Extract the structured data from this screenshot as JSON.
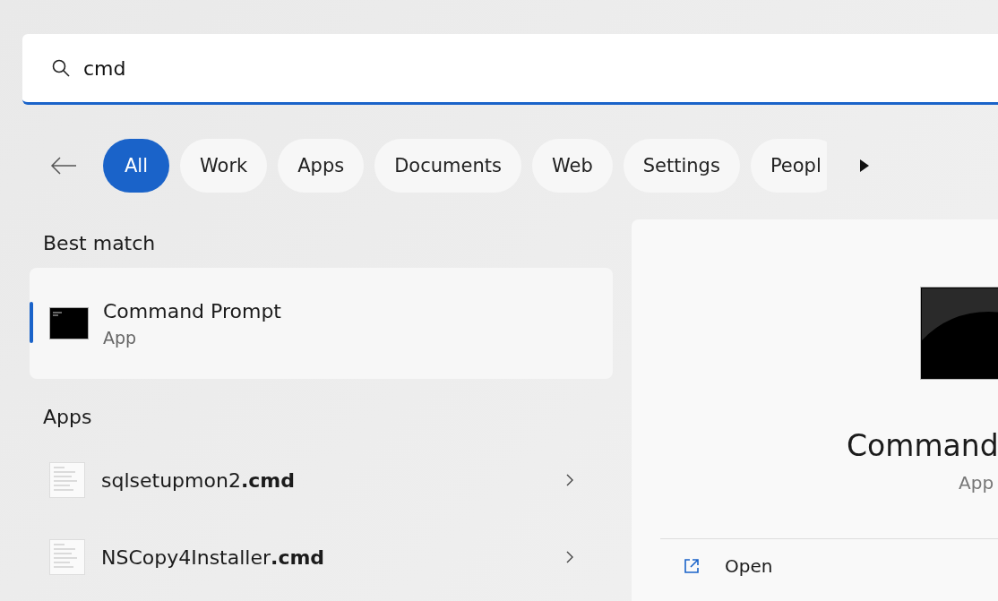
{
  "search": {
    "value": "cmd"
  },
  "filters": [
    {
      "label": "All",
      "selected": true
    },
    {
      "label": "Work",
      "selected": false
    },
    {
      "label": "Apps",
      "selected": false
    },
    {
      "label": "Documents",
      "selected": false
    },
    {
      "label": "Web",
      "selected": false
    },
    {
      "label": "Settings",
      "selected": false
    },
    {
      "label": "Peopl",
      "selected": false
    }
  ],
  "best_match": {
    "heading": "Best match",
    "title": "Command Prompt",
    "subtitle": "App",
    "selected": true
  },
  "apps": {
    "heading": "Apps",
    "items": [
      {
        "name": "sqlsetupmon2**.cmd**"
      },
      {
        "name": "NSCopy4Installer**.cmd**"
      }
    ]
  },
  "details": {
    "title": "Command",
    "subtitle": "App",
    "actions": [
      {
        "label": "Open"
      }
    ]
  }
}
